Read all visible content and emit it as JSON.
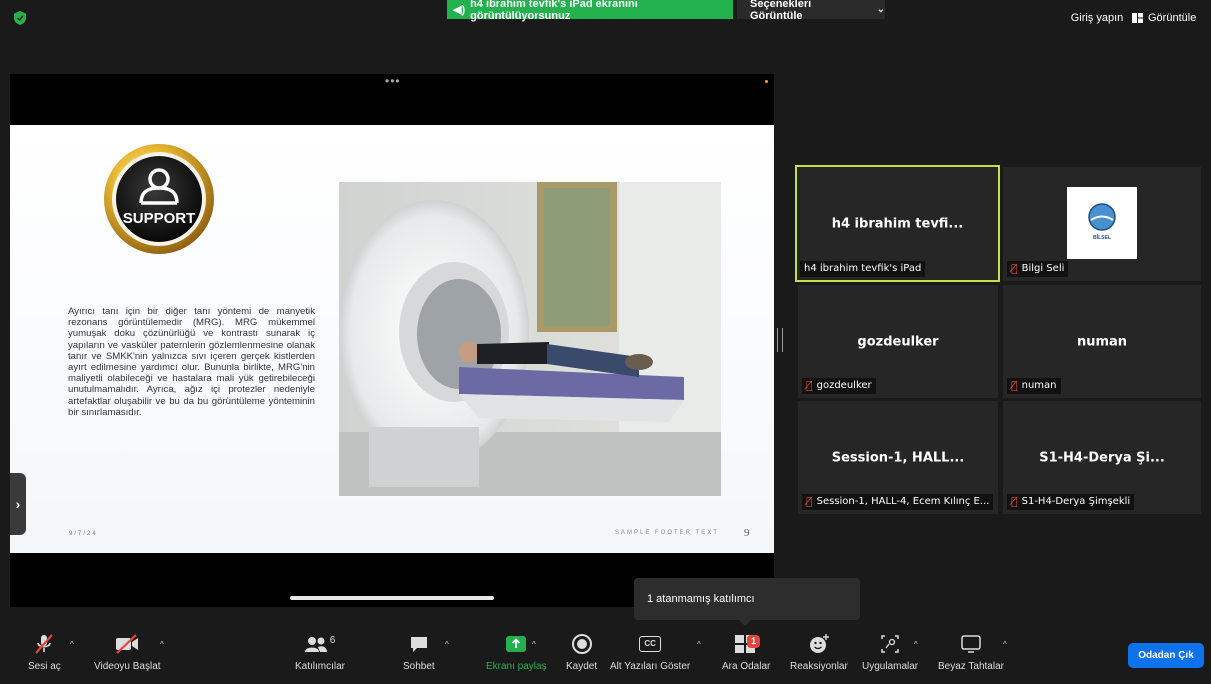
{
  "top_bar": {
    "share_banner": "h4 ibrahim tevfik's iPad ekranını görüntülüyorsunuz",
    "view_options": "Seçenekleri Görüntüle",
    "login": "Giriş yapın",
    "view": "Görüntüle"
  },
  "slide": {
    "logo_text": "SUPPORT",
    "body": "Ayırıcı tanı için bir diğer tanı yöntemi de manyetik rezonans görüntülemedir (MRG). MRG mükemmel yumuşak doku çözünürlüğü ve kontrastı sunarak iç yapıların ve vasküler paternlerin gözlemlenmesine olanak tanır ve SMKK'nin yalnızca sıvı içeren gerçek kistlerden ayırt edilmesine yardımcı olur. Bununla birlikte, MRG'nin maliyetli olabileceği ve hastalara mali yük getirebileceği unutulmamalıdır. Ayrıca, ağız içi protezler nedeniyle artefaktlar oluşabilir ve bu da bu görüntüleme yönteminin bir sınırlamasıdır.",
    "date": "9/7/24",
    "footer": "SAMPLE FOOTER TEXT",
    "page": "9"
  },
  "participants": [
    {
      "name": "h4 ibrahim tevfi...",
      "label": "h4 ibrahim tevfik's iPad",
      "muted": false,
      "active": true
    },
    {
      "name": "",
      "label": "Bilgi Seli",
      "muted": true,
      "logo_text": "BİLSEL"
    },
    {
      "name": "gozdeulker",
      "label": "gozdeulker",
      "muted": true
    },
    {
      "name": "numan",
      "label": "numan",
      "muted": true
    },
    {
      "name": "Session-1, HALL...",
      "label": "Session-1, HALL-4, Ecem Kılınç E...",
      "muted": true
    },
    {
      "name": "S1-H4-Derya Şi...",
      "label": "S1-H4-Derya Şimşekli",
      "muted": true
    }
  ],
  "tooltip": "1 atanmamış katılımcı",
  "toolbar": {
    "unmute": "Sesi aç",
    "start_video": "Videoyu Başlat",
    "participants": "Katılımcılar",
    "participants_count": "6",
    "chat": "Sohbet",
    "share_screen": "Ekranı paylaş",
    "record": "Kaydet",
    "captions": "Alt Yazıları Göster",
    "captions_icon": "CC",
    "breakout": "Ara Odalar",
    "breakout_badge": "1",
    "reactions": "Reaksiyonlar",
    "apps": "Uygulamalar",
    "whiteboard": "Beyaz Tahtalar",
    "leave": "Odadan Çık"
  },
  "colors": {
    "share_green": "#23b14d",
    "active_border": "#c2e04c",
    "leave_blue": "#0e72ed",
    "mute_red": "#e3453b"
  }
}
